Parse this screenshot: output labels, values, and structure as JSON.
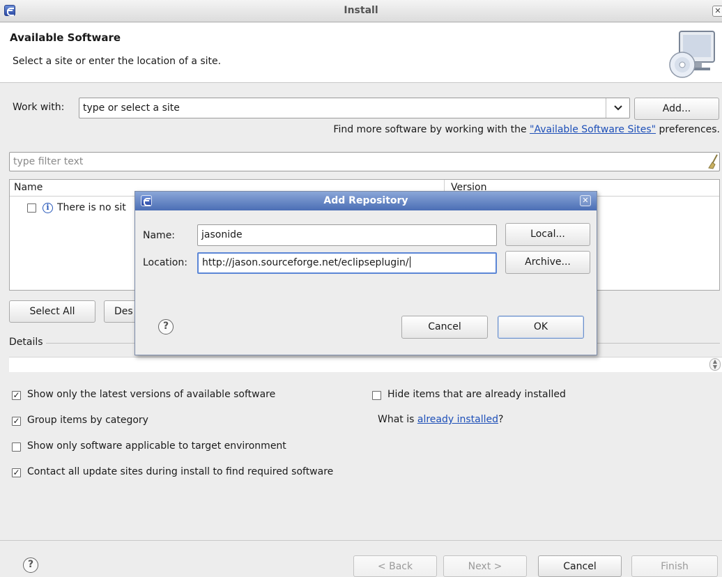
{
  "window": {
    "title": "Install"
  },
  "header": {
    "title": "Available Software",
    "description": "Select a site or enter the location of a site."
  },
  "work_with": {
    "label": "Work with:",
    "placeholder": "type or select a site",
    "add_label": "Add...",
    "hint_prefix": "Find more software by working with the ",
    "hint_link": "\"Available Software Sites\"",
    "hint_suffix": " preferences."
  },
  "filter": {
    "placeholder": "type filter text"
  },
  "table": {
    "columns": [
      "Name",
      "Version"
    ],
    "rows": [
      {
        "label": "There is no sit"
      }
    ]
  },
  "buttons_row": {
    "select_all": "Select All",
    "deselect_all": "Des"
  },
  "details": {
    "label": "Details"
  },
  "options": {
    "show_latest": {
      "label": "Show only the latest versions of available software",
      "checked": true
    },
    "group_by_category": {
      "label": "Group items by category",
      "checked": true
    },
    "show_applicable": {
      "label": "Show only software applicable to target environment",
      "checked": false
    },
    "contact_sites": {
      "label": "Contact all update sites during install to find required software",
      "checked": true
    },
    "hide_installed": {
      "label": "Hide items that are already installed",
      "checked": false
    }
  },
  "already_installed": {
    "prefix": "What is ",
    "link": "already installed",
    "suffix": "?"
  },
  "footer": {
    "back": "< Back",
    "next": "Next >",
    "cancel": "Cancel",
    "finish": "Finish"
  },
  "dialog": {
    "title": "Add Repository",
    "name_label": "Name:",
    "name_value": "jasonide",
    "location_label": "Location:",
    "location_value": "http://jason.sourceforge.net/eclipseplugin/",
    "local_label": "Local...",
    "archive_label": "Archive...",
    "cancel_label": "Cancel",
    "ok_label": "OK"
  },
  "colors": {
    "link": "#1d4fb8",
    "dialog_title_bar": "#4b6eb5"
  }
}
